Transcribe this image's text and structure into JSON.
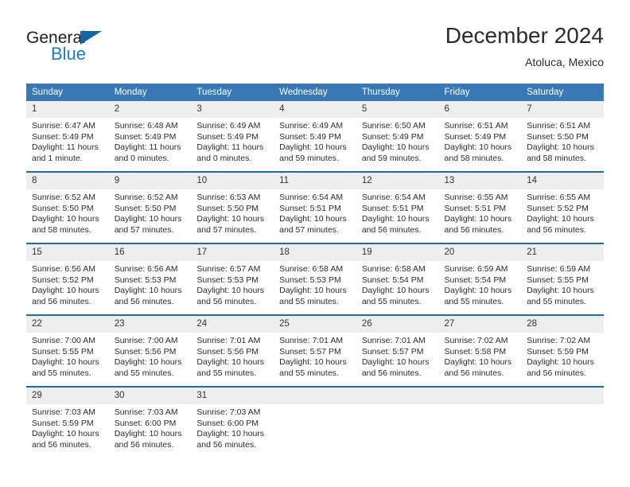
{
  "brand": {
    "name_part1": "General",
    "name_part2": "Blue",
    "triangle_color": "#1565a6",
    "blue_color": "#1f7bc1"
  },
  "header": {
    "month_title": "December 2024",
    "location": "Atoluca, Mexico"
  },
  "calendar": {
    "header_bg": "#3878b4",
    "row_rule_color": "#1f6bb0",
    "date_band_bg": "#eeeeee",
    "weekday_headers": [
      "Sunday",
      "Monday",
      "Tuesday",
      "Wednesday",
      "Thursday",
      "Friday",
      "Saturday"
    ],
    "weeks": [
      [
        {
          "date": "1",
          "sunrise": "Sunrise: 6:47 AM",
          "sunset": "Sunset: 5:49 PM",
          "daylight": "Daylight: 11 hours and 1 minute."
        },
        {
          "date": "2",
          "sunrise": "Sunrise: 6:48 AM",
          "sunset": "Sunset: 5:49 PM",
          "daylight": "Daylight: 11 hours and 0 minutes."
        },
        {
          "date": "3",
          "sunrise": "Sunrise: 6:49 AM",
          "sunset": "Sunset: 5:49 PM",
          "daylight": "Daylight: 11 hours and 0 minutes."
        },
        {
          "date": "4",
          "sunrise": "Sunrise: 6:49 AM",
          "sunset": "Sunset: 5:49 PM",
          "daylight": "Daylight: 10 hours and 59 minutes."
        },
        {
          "date": "5",
          "sunrise": "Sunrise: 6:50 AM",
          "sunset": "Sunset: 5:49 PM",
          "daylight": "Daylight: 10 hours and 59 minutes."
        },
        {
          "date": "6",
          "sunrise": "Sunrise: 6:51 AM",
          "sunset": "Sunset: 5:49 PM",
          "daylight": "Daylight: 10 hours and 58 minutes."
        },
        {
          "date": "7",
          "sunrise": "Sunrise: 6:51 AM",
          "sunset": "Sunset: 5:50 PM",
          "daylight": "Daylight: 10 hours and 58 minutes."
        }
      ],
      [
        {
          "date": "8",
          "sunrise": "Sunrise: 6:52 AM",
          "sunset": "Sunset: 5:50 PM",
          "daylight": "Daylight: 10 hours and 58 minutes."
        },
        {
          "date": "9",
          "sunrise": "Sunrise: 6:52 AM",
          "sunset": "Sunset: 5:50 PM",
          "daylight": "Daylight: 10 hours and 57 minutes."
        },
        {
          "date": "10",
          "sunrise": "Sunrise: 6:53 AM",
          "sunset": "Sunset: 5:50 PM",
          "daylight": "Daylight: 10 hours and 57 minutes."
        },
        {
          "date": "11",
          "sunrise": "Sunrise: 6:54 AM",
          "sunset": "Sunset: 5:51 PM",
          "daylight": "Daylight: 10 hours and 57 minutes."
        },
        {
          "date": "12",
          "sunrise": "Sunrise: 6:54 AM",
          "sunset": "Sunset: 5:51 PM",
          "daylight": "Daylight: 10 hours and 56 minutes."
        },
        {
          "date": "13",
          "sunrise": "Sunrise: 6:55 AM",
          "sunset": "Sunset: 5:51 PM",
          "daylight": "Daylight: 10 hours and 56 minutes."
        },
        {
          "date": "14",
          "sunrise": "Sunrise: 6:55 AM",
          "sunset": "Sunset: 5:52 PM",
          "daylight": "Daylight: 10 hours and 56 minutes."
        }
      ],
      [
        {
          "date": "15",
          "sunrise": "Sunrise: 6:56 AM",
          "sunset": "Sunset: 5:52 PM",
          "daylight": "Daylight: 10 hours and 56 minutes."
        },
        {
          "date": "16",
          "sunrise": "Sunrise: 6:56 AM",
          "sunset": "Sunset: 5:53 PM",
          "daylight": "Daylight: 10 hours and 56 minutes."
        },
        {
          "date": "17",
          "sunrise": "Sunrise: 6:57 AM",
          "sunset": "Sunset: 5:53 PM",
          "daylight": "Daylight: 10 hours and 56 minutes."
        },
        {
          "date": "18",
          "sunrise": "Sunrise: 6:58 AM",
          "sunset": "Sunset: 5:53 PM",
          "daylight": "Daylight: 10 hours and 55 minutes."
        },
        {
          "date": "19",
          "sunrise": "Sunrise: 6:58 AM",
          "sunset": "Sunset: 5:54 PM",
          "daylight": "Daylight: 10 hours and 55 minutes."
        },
        {
          "date": "20",
          "sunrise": "Sunrise: 6:59 AM",
          "sunset": "Sunset: 5:54 PM",
          "daylight": "Daylight: 10 hours and 55 minutes."
        },
        {
          "date": "21",
          "sunrise": "Sunrise: 6:59 AM",
          "sunset": "Sunset: 5:55 PM",
          "daylight": "Daylight: 10 hours and 55 minutes."
        }
      ],
      [
        {
          "date": "22",
          "sunrise": "Sunrise: 7:00 AM",
          "sunset": "Sunset: 5:55 PM",
          "daylight": "Daylight: 10 hours and 55 minutes."
        },
        {
          "date": "23",
          "sunrise": "Sunrise: 7:00 AM",
          "sunset": "Sunset: 5:56 PM",
          "daylight": "Daylight: 10 hours and 55 minutes."
        },
        {
          "date": "24",
          "sunrise": "Sunrise: 7:01 AM",
          "sunset": "Sunset: 5:56 PM",
          "daylight": "Daylight: 10 hours and 55 minutes."
        },
        {
          "date": "25",
          "sunrise": "Sunrise: 7:01 AM",
          "sunset": "Sunset: 5:57 PM",
          "daylight": "Daylight: 10 hours and 55 minutes."
        },
        {
          "date": "26",
          "sunrise": "Sunrise: 7:01 AM",
          "sunset": "Sunset: 5:57 PM",
          "daylight": "Daylight: 10 hours and 56 minutes."
        },
        {
          "date": "27",
          "sunrise": "Sunrise: 7:02 AM",
          "sunset": "Sunset: 5:58 PM",
          "daylight": "Daylight: 10 hours and 56 minutes."
        },
        {
          "date": "28",
          "sunrise": "Sunrise: 7:02 AM",
          "sunset": "Sunset: 5:59 PM",
          "daylight": "Daylight: 10 hours and 56 minutes."
        }
      ],
      [
        {
          "date": "29",
          "sunrise": "Sunrise: 7:03 AM",
          "sunset": "Sunset: 5:59 PM",
          "daylight": "Daylight: 10 hours and 56 minutes."
        },
        {
          "date": "30",
          "sunrise": "Sunrise: 7:03 AM",
          "sunset": "Sunset: 6:00 PM",
          "daylight": "Daylight: 10 hours and 56 minutes."
        },
        {
          "date": "31",
          "sunrise": "Sunrise: 7:03 AM",
          "sunset": "Sunset: 6:00 PM",
          "daylight": "Daylight: 10 hours and 56 minutes."
        },
        {
          "date": "",
          "sunrise": "",
          "sunset": "",
          "daylight": ""
        },
        {
          "date": "",
          "sunrise": "",
          "sunset": "",
          "daylight": ""
        },
        {
          "date": "",
          "sunrise": "",
          "sunset": "",
          "daylight": ""
        },
        {
          "date": "",
          "sunrise": "",
          "sunset": "",
          "daylight": ""
        }
      ]
    ]
  }
}
